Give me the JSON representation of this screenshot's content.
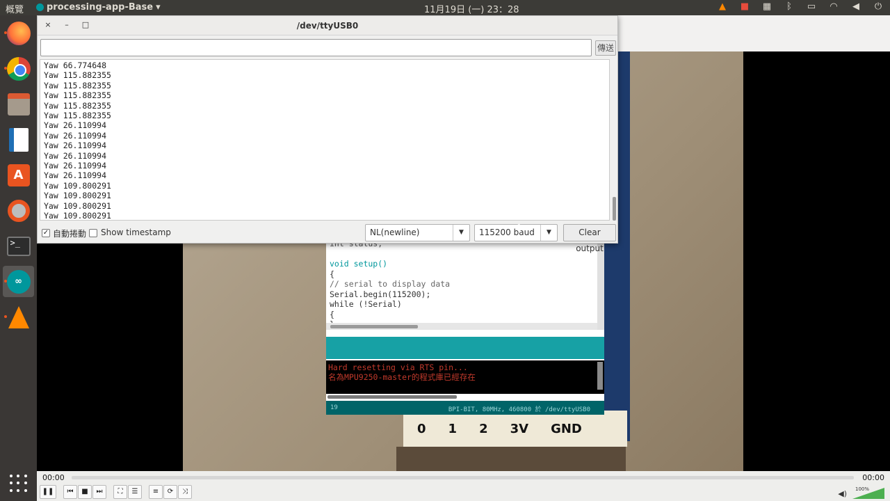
{
  "topbar": {
    "activities": "概覽",
    "app_name": "processing-app-Base",
    "app_menu_arrow": "▾",
    "clock": "11月19日 (一) 23：28",
    "tray_icons": [
      "vlc-icon",
      "camera-icon",
      "keyboard-icon",
      "bluetooth-icon",
      "keyboard-layout-icon",
      "wifi-icon",
      "volume-icon",
      "power-icon"
    ]
  },
  "dock": {
    "items": [
      "firefox",
      "chrome",
      "files",
      "writer",
      "software-center",
      "settings",
      "terminal",
      "arduino",
      "vlc"
    ]
  },
  "serial_monitor": {
    "title": "/dev/ttyUSB0",
    "close_glyph": "×",
    "minimize_glyph": "–",
    "maximize_glyph": "□",
    "send_input_value": "",
    "send_label": "傳送",
    "output_lines": [
      "Yaw 66.774648",
      "Yaw 115.882355",
      "Yaw 115.882355",
      "Yaw 115.882355",
      "Yaw 115.882355",
      "Yaw 115.882355",
      "Yaw 26.110994",
      "Yaw 26.110994",
      "Yaw 26.110994",
      "Yaw 26.110994",
      "Yaw 26.110994",
      "Yaw 26.110994",
      "Yaw 109.800291",
      "Yaw 109.800291",
      "Yaw 109.800291",
      "Yaw 109.800291"
    ],
    "autoscroll_label": "自動捲動",
    "autoscroll_checked": true,
    "timestamp_label": "Show timestamp",
    "timestamp_checked": false,
    "line_ending": "NL(newline)",
    "baud": "115200 baud",
    "clear_label": "Clear output"
  },
  "ide": {
    "code_lines": [
      {
        "text": "int status;",
        "class": ""
      },
      {
        "text": "",
        "class": ""
      },
      {
        "text": "void setup()",
        "class": ""
      },
      {
        "text": "{",
        "class": ""
      },
      {
        "text": "  // serial to display data",
        "class": "cm"
      },
      {
        "text": "  Serial.begin(115200);",
        "class": ""
      },
      {
        "text": "  while (!Serial)",
        "class": ""
      },
      {
        "text": "  {",
        "class": ""
      },
      {
        "text": "  }",
        "class": ""
      }
    ],
    "console_lines": [
      "Hard resetting via RTS pin...",
      "名為MPU9250-master的程式庫已經存在"
    ],
    "footer_line": "19",
    "footer_board": "BPI-BIT, 80MHz, 460800 於 /dev/ttyUSB0"
  },
  "board_pins": [
    "0",
    "1",
    "2",
    "3V",
    "GND"
  ],
  "vlc": {
    "time_elapsed": "00:00",
    "time_total": "00:00",
    "volume_label": "100%",
    "volume_level": 1.0
  },
  "colors": {
    "arduino_teal": "#17a1a5",
    "ubuntu_orange": "#e95420",
    "console_error": "#c0392b"
  }
}
